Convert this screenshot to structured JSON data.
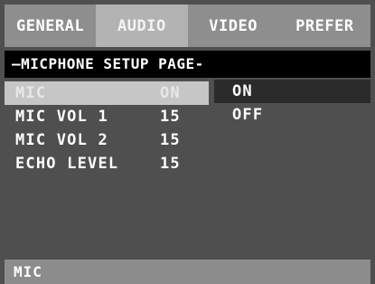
{
  "tabs": [
    {
      "label": "GENERAL"
    },
    {
      "label": "AUDIO"
    },
    {
      "label": "VIDEO"
    },
    {
      "label": "PREFER"
    }
  ],
  "active_tab": "AUDIO",
  "page_title": "—MICPHONE SETUP PAGE-",
  "settings": [
    {
      "label": "MIC",
      "value": "ON"
    },
    {
      "label": "MIC VOL 1",
      "value": "15"
    },
    {
      "label": "MIC VOL 2",
      "value": "15"
    },
    {
      "label": "ECHO LEVEL",
      "value": "15"
    }
  ],
  "options": [
    {
      "label": "ON"
    },
    {
      "label": "OFF"
    }
  ],
  "status_text": "MIC"
}
